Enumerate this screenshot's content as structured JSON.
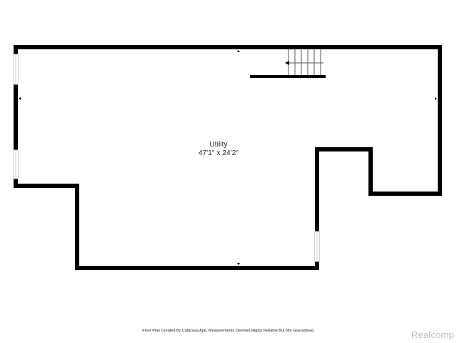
{
  "room": {
    "name": "Utility",
    "dimensions": "47'1\" x 24'2\""
  },
  "footer": {
    "note": "Floor Plan Created By Cubicasa App. Measurements Deemed Highly Reliable But Not Guaranteed."
  },
  "watermark": {
    "text": "Realcomp"
  },
  "colors": {
    "wall": "#000000",
    "window": "#d9d9d9",
    "stairs": "#555555",
    "watermark": "#c2c2c2"
  }
}
